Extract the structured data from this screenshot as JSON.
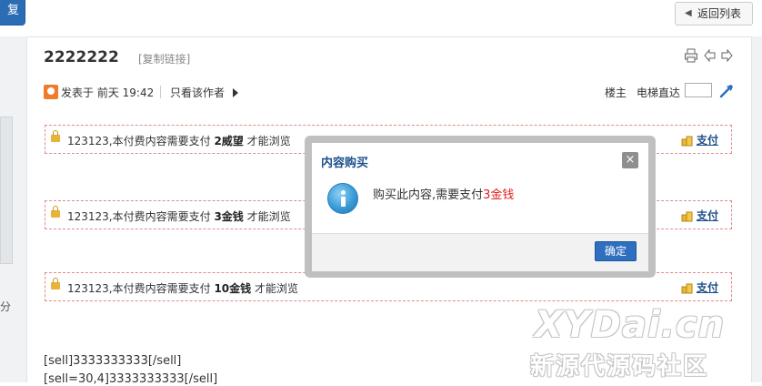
{
  "header": {
    "top_left_button_label": "复",
    "back_button_label": "返回列表"
  },
  "post": {
    "title": "2222222",
    "copy_link": "[复制链接]",
    "meta": {
      "posted": "发表于 前天 19:42",
      "only_author": "只看该作者",
      "floor": "楼主",
      "elevator": "电梯直达"
    },
    "pay_blocks": [
      {
        "prefix": "123123,本付费内容需要支付 ",
        "amount": "2威望",
        "suffix": " 才能浏览",
        "pay_label": "支付"
      },
      {
        "prefix": "123123,本付费内容需要支付 ",
        "amount": "3金钱",
        "suffix": " 才能浏览",
        "pay_label": "支付"
      },
      {
        "prefix": "123123,本付费内容需要支付 ",
        "amount": "10金钱",
        "suffix": " 才能浏览",
        "pay_label": "支付"
      }
    ],
    "bbcode_lines": [
      "[sell]3333333333[/sell]",
      "[sell=30,4]3333333333[/sell]"
    ]
  },
  "left_side_text": "分",
  "dialog": {
    "title": "内容购买",
    "close_label": "×",
    "message_prefix": "购买此内容,需要支付",
    "message_price": "3金钱",
    "ok_label": "确定"
  },
  "watermark": {
    "line1": "XYDai.cn",
    "line2": "新源代源码社区"
  },
  "colors": {
    "accent_blue": "#2f6fbf",
    "price_red": "#e21b1b",
    "dashed_border": "#e38b8b"
  }
}
